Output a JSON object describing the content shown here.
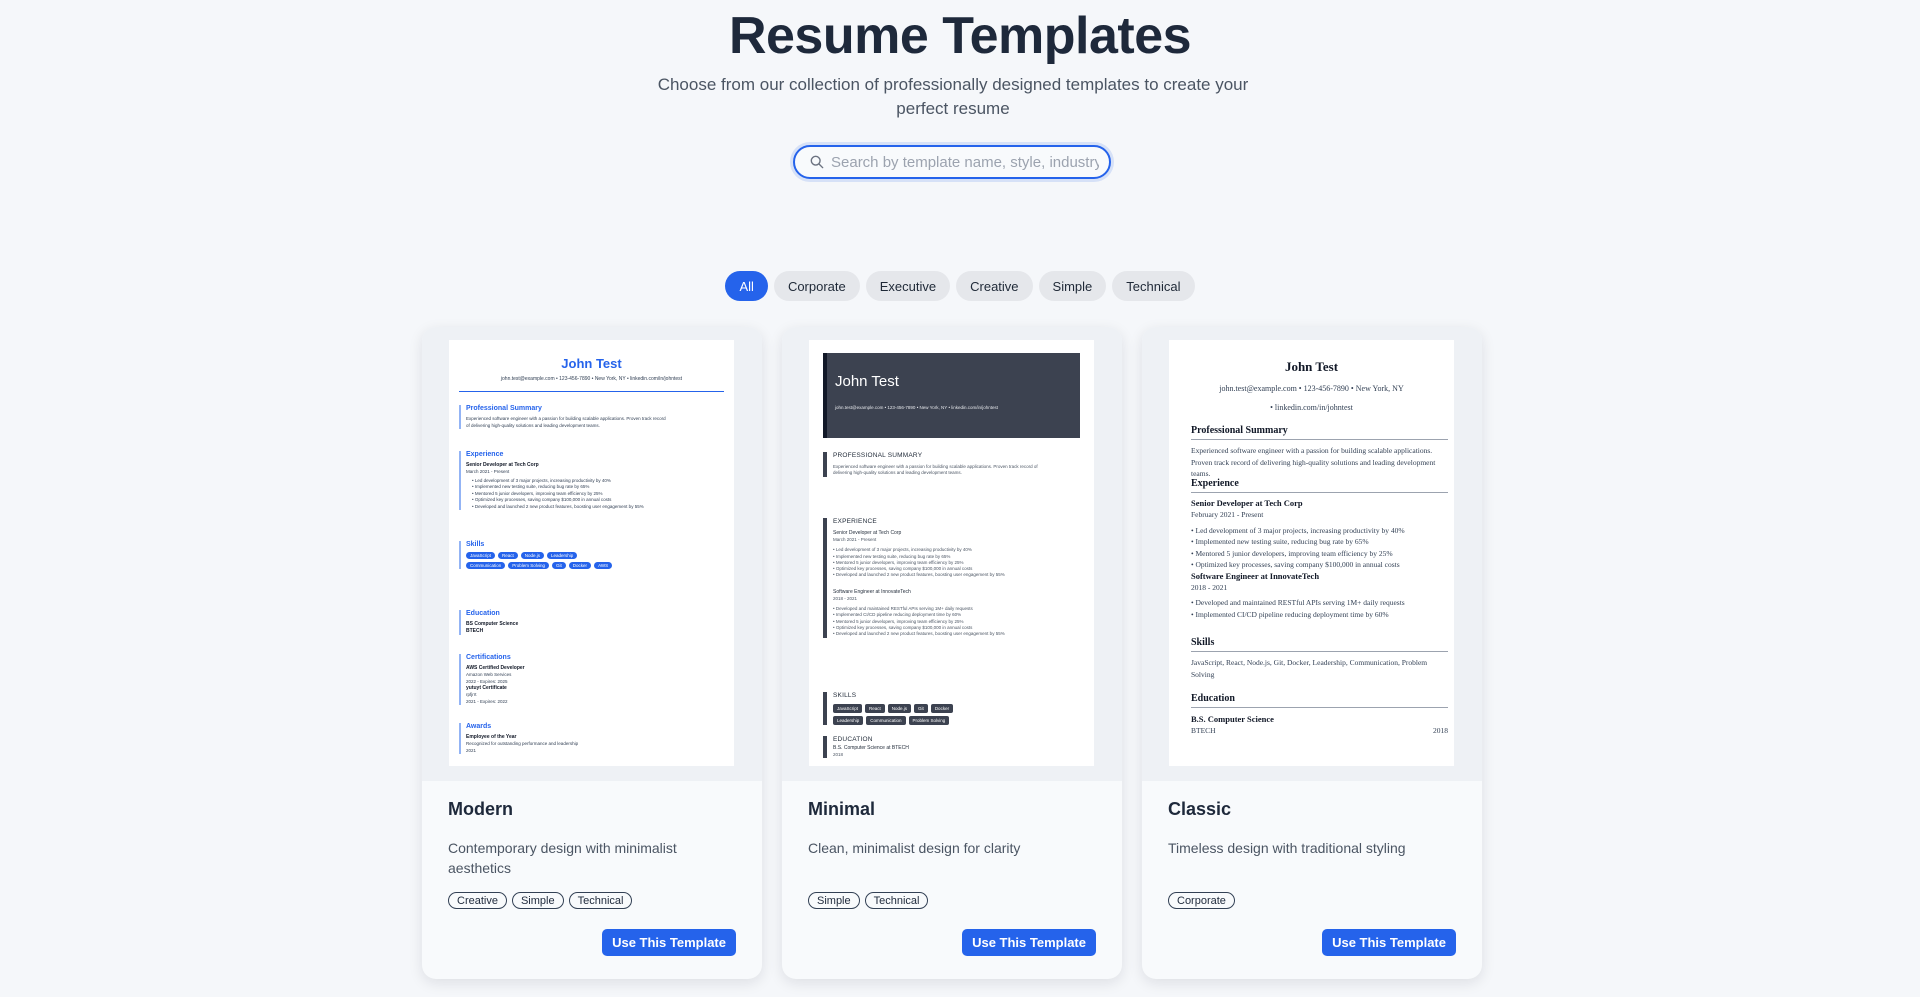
{
  "header": {
    "title": "Resume Templates",
    "subtitle": "Choose from our collection of professionally designed templates to create your perfect resume"
  },
  "search": {
    "placeholder": "Search by template name, style, industry, or",
    "icon": "search-icon"
  },
  "filters": [
    "All",
    "Corporate",
    "Executive",
    "Creative",
    "Simple",
    "Technical"
  ],
  "active_filter": "All",
  "accent_color": "#2563eb",
  "templates": [
    {
      "name": "Modern",
      "description": "Contemporary design with minimalist aesthetics",
      "tags": [
        "Creative",
        "Simple",
        "Technical"
      ],
      "button": "Use This Template"
    },
    {
      "name": "Minimal",
      "description": "Clean, minimalist design for clarity",
      "tags": [
        "Simple",
        "Technical"
      ],
      "button": "Use This Template"
    },
    {
      "name": "Classic",
      "description": "Timeless design with traditional styling",
      "tags": [
        "Corporate"
      ],
      "button": "Use This Template"
    }
  ],
  "resume_sample": {
    "name": "John Test",
    "contact_line": "john.test@example.com • 123-456-7890 • New York, NY • linkedin.com/in/johntest",
    "contact_email_phone_city": "john.test@example.com • 123-456-7890 • New York, NY",
    "contact_linkedin": "• linkedin.com/in/johntest",
    "summary_heading": "Professional Summary",
    "summary_heading_caps": "PROFESSIONAL SUMMARY",
    "summary": "Experienced software engineer with a passion for building scalable applications. Proven track record of delivering high-quality solutions and leading development teams.",
    "experience_heading": "Experience",
    "experience_heading_caps": "EXPERIENCE",
    "job1_title": "Senior Developer at Tech Corp",
    "job1_dates": "March 2021 - Present",
    "job1_dates_classic": "February 2021 - Present",
    "job1_bullets": [
      "Led development of 3 major projects, increasing productivity by 40%",
      "Implemented new testing suite, reducing bug rate by 65%",
      "Mentored 5 junior developers, improving team efficiency by 25%",
      "Optimized key processes, saving company $100,000 in annual costs",
      "Developed and launched 2 new product features, boosting user engagement by 55%"
    ],
    "job2_title": "Software Engineer at InnovateTech",
    "job2_dates": "2018 - 2021",
    "job2_bullets": [
      "Developed and maintained RESTful APIs serving 1M+ daily requests",
      "Implemented CI/CD pipeline reducing deployment time by 60%",
      "Mentored 5 junior developers, improving team efficiency by 25%",
      "Optimized key processes, saving company $100,000 in annual costs",
      "Developed and launched 2 new product features, boosting user engagement by 55%"
    ],
    "job2_bullets_classic": [
      "Developed and maintained RESTful APIs serving 1M+ daily requests",
      "Implemented CI/CD pipeline reducing deployment time by 60%"
    ],
    "classic_job1_bullets": [
      "Led development of 3 major projects, increasing productivity by 40%",
      "Implemented new testing suite, reducing bug rate by 65%",
      "Mentored 5 junior developers, improving team efficiency by 25%",
      "Optimized key processes, saving company $100,000 in annual costs"
    ],
    "skills_heading": "Skills",
    "skills_heading_caps": "SKILLS",
    "skills": [
      "JavaScript",
      "React",
      "Node.js",
      "Leadership",
      "Communication",
      "Problem Solving",
      "Git",
      "Docker",
      "AWS"
    ],
    "skills_minimal": [
      "JavaScript",
      "React",
      "Node.js",
      "Git",
      "Docker",
      "Leadership",
      "Communication",
      "Problem Solving"
    ],
    "skills_classic": "JavaScript, React, Node.js, Git, Docker, Leadership, Communication, Problem Solving",
    "education_heading": "Education",
    "education_heading_caps": "EDUCATION",
    "degree": "BS Computer Science",
    "degree_classic": "B.S. Computer Science",
    "school": "BTECH",
    "degree_minimal": "B.S. Computer Science at BTECH",
    "edu_year": "2018",
    "certifications_heading": "Certifications",
    "cert1_name": "AWS Certified Developer",
    "cert1_issuer": "Amazon Web Services",
    "cert1_dates": "2022 - Expires: 2025",
    "cert2_name": "yutuyt Certificate",
    "cert2_issuer": "rpfjrrt",
    "cert2_dates": "2021 - Expires: 2022",
    "awards_heading": "Awards",
    "award1_name": "Employee of the Year",
    "award1_desc": "Recognized for outstanding performance and leadership",
    "award1_year": "2021"
  }
}
